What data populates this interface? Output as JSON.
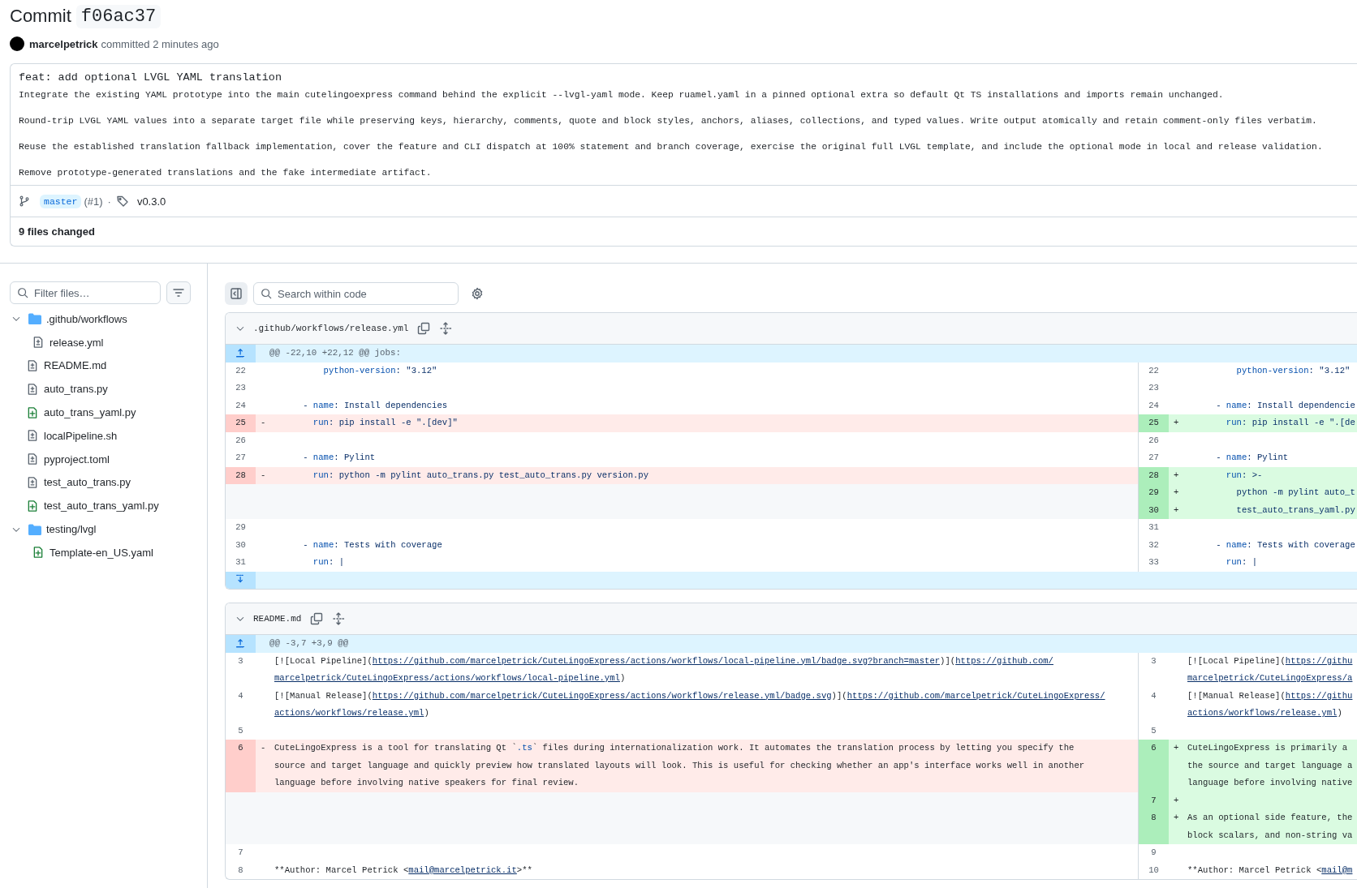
{
  "header": {
    "title": "Commit",
    "hash": "f06ac37",
    "author": "marcelpetrick",
    "when": "committed 2 minutes ago"
  },
  "message": {
    "title": "feat: add optional LVGL YAML translation",
    "paragraphs": [
      "Integrate the existing YAML prototype into the main cutelingoexpress command behind the explicit --lvgl-yaml mode. Keep ruamel.yaml in a pinned optional extra so default Qt TS installations and imports remain unchanged.",
      "Round-trip LVGL YAML values into a separate target file while preserving keys, hierarchy, comments, quote and block styles, anchors, aliases, collections, and typed values. Write output atomically and retain comment-only files verbatim.",
      "Reuse the established translation fallback implementation, cover the feature and CLI dispatch at 100% statement and branch coverage, exercise the original full LVGL template, and include the optional mode in local and release validation.",
      "Remove prototype-generated translations and the fake intermediate artifact."
    ]
  },
  "refs": {
    "branch": "master",
    "pr": "(#1)",
    "separator": "·",
    "tag": "v0.3.0"
  },
  "summary": "9 files changed",
  "sidebar": {
    "filter": {
      "placeholder": "Filter files…"
    },
    "tree": [
      {
        "name": ".github/workflows",
        "kind": "folder",
        "expanded": true,
        "children": [
          {
            "name": "release.yml",
            "kind": "modified"
          }
        ]
      },
      {
        "name": "README.md",
        "kind": "modified"
      },
      {
        "name": "auto_trans.py",
        "kind": "modified"
      },
      {
        "name": "auto_trans_yaml.py",
        "kind": "added"
      },
      {
        "name": "localPipeline.sh",
        "kind": "modified"
      },
      {
        "name": "pyproject.toml",
        "kind": "modified"
      },
      {
        "name": "test_auto_trans.py",
        "kind": "modified"
      },
      {
        "name": "test_auto_trans_yaml.py",
        "kind": "added"
      },
      {
        "name": "testing/lvgl",
        "kind": "folder",
        "expanded": true,
        "children": [
          {
            "name": "Template-en_US.yaml",
            "kind": "added"
          }
        ]
      }
    ]
  },
  "toolbar": {
    "search": {
      "placeholder": "Search within code"
    }
  },
  "diffs": [
    {
      "file": ".github/workflows/release.yml",
      "kind": "yaml",
      "expanded": true,
      "hunk": "@@ -22,10 +22,12 @@ jobs:",
      "expander_below": true,
      "rows": [
        {
          "left": {
            "num": "22",
            "kind": "context",
            "code": [
              [
                {
                  "kind": "key",
                  "text": "          python-version"
                },
                ": \"3.12\""
              ]
            ]
          },
          "right": {
            "num": "22",
            "kind": "context",
            "code": [
              [
                {
                  "kind": "key",
                  "text": "          python-version"
                },
                ": \"3.12\""
              ]
            ]
          }
        },
        {
          "left": {
            "num": "23",
            "kind": "context"
          },
          "right": {
            "num": "23",
            "kind": "context"
          }
        },
        {
          "left": {
            "num": "24",
            "kind": "context",
            "code": [
              [
                "      - ",
                {
                  "kind": "key",
                  "text": "name"
                },
                ": Install dependencies"
              ]
            ]
          },
          "right": {
            "num": "24",
            "kind": "context",
            "code": [
              [
                "      - ",
                {
                  "kind": "key",
                  "text": "name"
                },
                ": Install dependencie"
              ]
            ]
          }
        },
        {
          "left": {
            "num": "25",
            "kind": "deletion",
            "sign": "-",
            "code": [
              [
                {
                  "kind": "key",
                  "text": "        run"
                },
                ": pip install -e \".[dev]\""
              ]
            ]
          },
          "right": {
            "num": "25",
            "kind": "addition",
            "sign": "+",
            "code": [
              [
                {
                  "kind": "key",
                  "text": "        run"
                },
                ": pip install -e \".[de"
              ]
            ]
          }
        },
        {
          "left": {
            "num": "26",
            "kind": "context"
          },
          "right": {
            "num": "26",
            "kind": "context"
          }
        },
        {
          "left": {
            "num": "27",
            "kind": "context",
            "code": [
              [
                "      - ",
                {
                  "kind": "key",
                  "text": "name"
                },
                ": Pylint"
              ]
            ]
          },
          "right": {
            "num": "27",
            "kind": "context",
            "code": [
              [
                "      - ",
                {
                  "kind": "key",
                  "text": "name"
                },
                ": Pylint"
              ]
            ]
          }
        },
        {
          "left": {
            "num": "28",
            "kind": "deletion",
            "sign": "-",
            "code": [
              [
                {
                  "kind": "key",
                  "text": "        run"
                },
                ": python -m pylint auto_trans.py test_auto_trans.py version.py"
              ]
            ]
          },
          "right": {
            "num": "28",
            "kind": "addition",
            "sign": "+",
            "code": [
              [
                {
                  "kind": "key",
                  "text": "        run"
                },
                ": >-"
              ]
            ]
          }
        },
        {
          "right": {
            "num": "29",
            "kind": "addition",
            "sign": "+",
            "code": [
              [
                "          python -m pylint auto_t"
              ]
            ]
          }
        },
        {
          "right": {
            "num": "30",
            "kind": "addition",
            "sign": "+",
            "code": [
              [
                "          test_auto_trans_yaml.py"
              ]
            ]
          }
        },
        {
          "left": {
            "num": "29",
            "kind": "context"
          },
          "right": {
            "num": "31",
            "kind": "context"
          }
        },
        {
          "left": {
            "num": "30",
            "kind": "context",
            "code": [
              [
                "      - ",
                {
                  "kind": "key",
                  "text": "name"
                },
                ": Tests with coverage"
              ]
            ]
          },
          "right": {
            "num": "32",
            "kind": "context",
            "code": [
              [
                "      - ",
                {
                  "kind": "key",
                  "text": "name"
                },
                ": Tests with coverage"
              ]
            ]
          }
        },
        {
          "left": {
            "num": "31",
            "kind": "context",
            "code": [
              [
                {
                  "kind": "key",
                  "text": "        run"
                },
                ": |"
              ]
            ]
          },
          "right": {
            "num": "33",
            "kind": "context",
            "code": [
              [
                {
                  "kind": "key",
                  "text": "        run"
                },
                ": |"
              ]
            ]
          }
        }
      ]
    },
    {
      "file": "README.md",
      "kind": "markdown",
      "expanded": true,
      "hunk": "@@ -3,7 +3,9 @@",
      "rows": [
        {
          "left": {
            "num": "3",
            "kind": "context",
            "code": [
              [
                "[![Local Pipeline](",
                {
                  "kind": "link",
                  "text": "https://github.com/marcelpetrick/CuteLingoExpress/actions/workflows/local-pipeline.yml/badge.svg?branch=master"
                },
                ")](",
                {
                  "kind": "link",
                  "text": "https://github.com/"
                }
              ],
              [
                {
                  "kind": "link",
                  "text": "marcelpetrick/CuteLingoExpress/actions/workflows/local-pipeline.yml"
                },
                ")"
              ]
            ]
          },
          "right": {
            "num": "3",
            "kind": "context",
            "code": [
              [
                "[![Local Pipeline](",
                {
                  "kind": "link",
                  "text": "https://githu"
                }
              ],
              [
                {
                  "kind": "link",
                  "text": "marcelpetrick/CuteLingoExpress/a"
                }
              ]
            ]
          }
        },
        {
          "left": {
            "num": "4",
            "kind": "context",
            "code": [
              [
                "[![Manual Release](",
                {
                  "kind": "link",
                  "text": "https://github.com/marcelpetrick/CuteLingoExpress/actions/workflows/release.yml/badge.svg"
                },
                ")](",
                {
                  "kind": "link",
                  "text": "https://github.com/marcelpetrick/CuteLingoExpress/"
                }
              ],
              [
                {
                  "kind": "link",
                  "text": "actions/workflows/release.yml"
                },
                ")"
              ]
            ]
          },
          "right": {
            "num": "4",
            "kind": "context",
            "code": [
              [
                "[![Manual Release](",
                {
                  "kind": "link",
                  "text": "https://githu"
                }
              ],
              [
                {
                  "kind": "link",
                  "text": "actions/workflows/release.yml"
                },
                ")"
              ]
            ]
          }
        },
        {
          "left": {
            "num": "5",
            "kind": "context"
          },
          "right": {
            "num": "5",
            "kind": "context"
          }
        },
        {
          "left": {
            "num": "6",
            "kind": "deletion",
            "sign": "-",
            "code": [
              [
                "CuteLingoExpress is a tool for translating Qt `",
                {
                  "kind": "code",
                  "text": ".ts"
                },
                "` files during internationalization work. It automates the translation process by letting you specify the"
              ],
              [
                "source and target language and quickly preview how translated layouts will look. This is useful for checking whether an app's interface works well in another"
              ],
              [
                "language before involving native speakers for final review."
              ]
            ]
          },
          "right": {
            "num": "6",
            "kind": "addition",
            "sign": "+",
            "code": [
              [
                "CuteLingoExpress is primarily a"
              ],
              [
                "the source and target language a"
              ],
              [
                "language before involving native"
              ]
            ]
          }
        },
        {
          "right": {
            "num": "7",
            "kind": "addition",
            "sign": "+"
          }
        },
        {
          "right": {
            "num": "8",
            "kind": "addition",
            "sign": "+",
            "code": [
              [
                "As an optional side feature, the"
              ],
              [
                "block scalars, and non-string va"
              ]
            ]
          }
        },
        {
          "left": {
            "num": "7",
            "kind": "context"
          },
          "right": {
            "num": "9",
            "kind": "context"
          }
        },
        {
          "left": {
            "num": "8",
            "kind": "context",
            "code": [
              [
                "**Author: Marcel Petrick <",
                {
                  "kind": "link",
                  "text": "mail@marcelpetrick.it"
                },
                ">**"
              ]
            ]
          },
          "right": {
            "num": "10",
            "kind": "context",
            "code": [
              [
                "**Author: Marcel Petrick <",
                {
                  "kind": "link",
                  "text": "mail@m"
                }
              ]
            ]
          }
        }
      ]
    }
  ]
}
